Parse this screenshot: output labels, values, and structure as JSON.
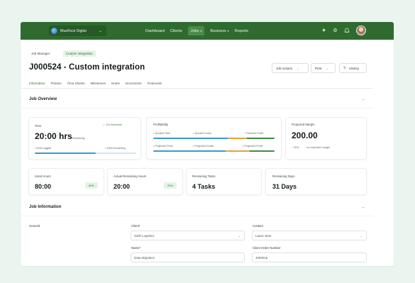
{
  "header": {
    "org_name": "BlueRock Digital",
    "nav": [
      "Dashboard",
      "Clients",
      "Jobs",
      "Business",
      "Reports"
    ],
    "active_nav": "Jobs",
    "icons": [
      "sparkle-icon",
      "settings-icon",
      "bell-icon"
    ]
  },
  "breadcrumb": [
    "Job Manager",
    "Custom integration"
  ],
  "job": {
    "title": "J000524 - Custom integration",
    "actions_label": "Job Actions",
    "print_label": "Print",
    "history_label": "History"
  },
  "tabs": [
    "Information",
    "Phases",
    "Time Sheets",
    "Milestones",
    "Notes",
    "Documents",
    "Financials"
  ],
  "active_tab": "Information",
  "overview": {
    "section_title": "Job Overview",
    "time": {
      "label": "Time",
      "value": "20:00 hrs",
      "suffix": "Remaining",
      "status": "On Schedule",
      "logged": "4030 logged",
      "remaining": "2000 remaining",
      "progress": 0.6
    },
    "profitability": {
      "label": "Profitability",
      "quoted_time": "Quoted Time",
      "quoted_costs": "Quoted Costs",
      "planned_profit": "Planned Profit",
      "projected_time": "Projected Time",
      "projected_costs": "Projected Costs",
      "projected_profit": "Projected Profit"
    },
    "margin": {
      "label": "Projected Margin",
      "value": "200.00",
      "change": "20%",
      "change_text": "vs expected margin"
    },
    "stats": [
      {
        "label": "Used Hours",
        "value": "80:00",
        "badge": "80%"
      },
      {
        "label": "Actual Remaining Hours",
        "value": "20:00",
        "badge": "20%"
      },
      {
        "label": "Remaining Tasks",
        "value": "4 Tasks"
      },
      {
        "label": "Remaining Days",
        "value": "31 Days"
      }
    ]
  },
  "information": {
    "section_title": "Job Information",
    "group_label": "General",
    "client": {
      "label": "Client*",
      "value": "Swift Logistics"
    },
    "contact": {
      "label": "Contact",
      "value": "Laura Jane"
    },
    "name": {
      "label": "Name*",
      "value": "Data Migration"
    },
    "order": {
      "label": "Client Order Number",
      "value": "J000518"
    }
  },
  "colors": {
    "brand": "#2f6b2f",
    "bar_blue": "#3a9ad0",
    "bar_orange": "#e6a23a",
    "bar_green": "#3f8a45",
    "badge_bg": "#e3f4e6"
  }
}
